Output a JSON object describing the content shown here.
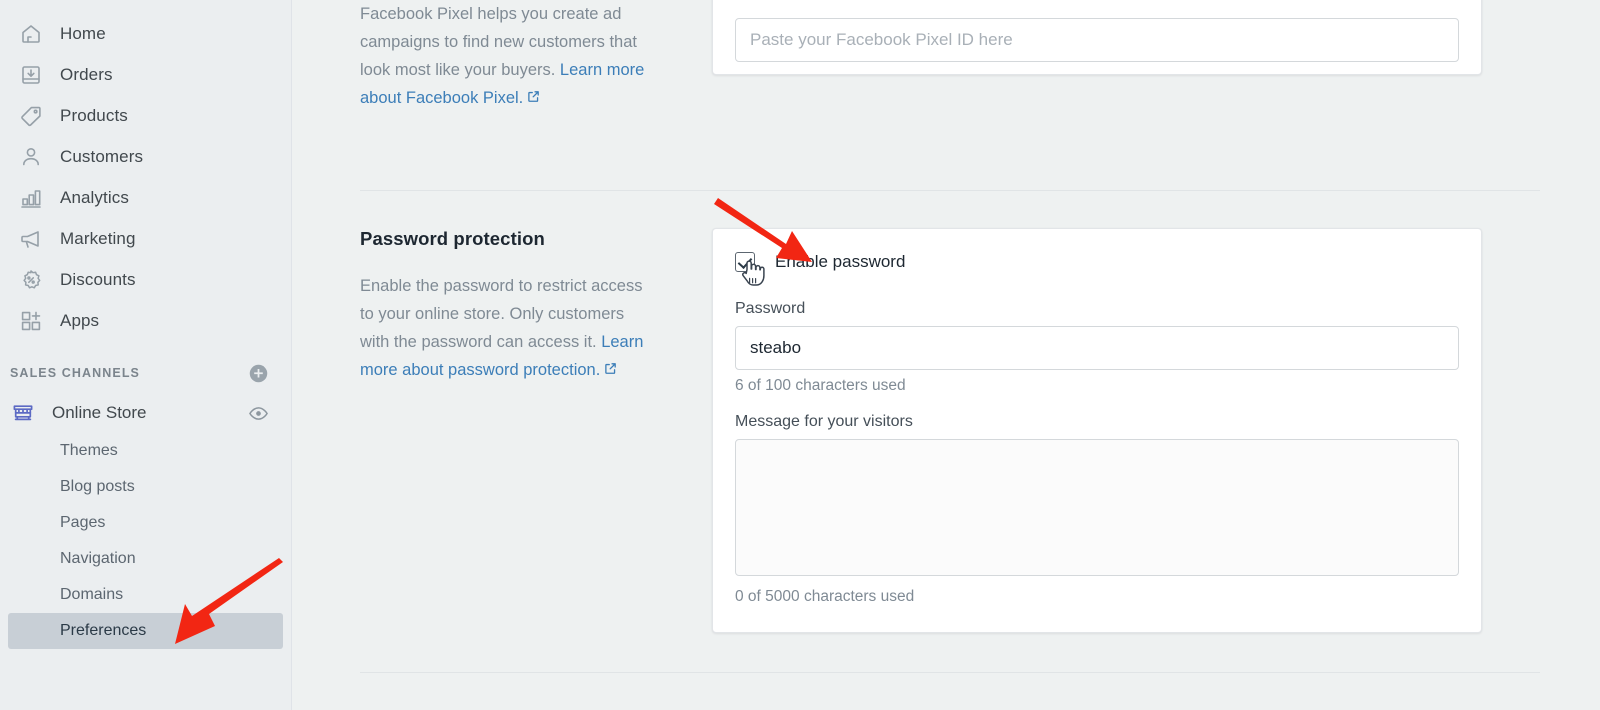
{
  "sidebar": {
    "nav": [
      {
        "label": "Home",
        "icon": "home-icon"
      },
      {
        "label": "Orders",
        "icon": "orders-icon"
      },
      {
        "label": "Products",
        "icon": "products-tag-icon"
      },
      {
        "label": "Customers",
        "icon": "customers-person-icon"
      },
      {
        "label": "Analytics",
        "icon": "analytics-bar-chart-icon"
      },
      {
        "label": "Marketing",
        "icon": "marketing-megaphone-icon"
      },
      {
        "label": "Discounts",
        "icon": "discounts-percent-badge-icon"
      },
      {
        "label": "Apps",
        "icon": "apps-grid-plus-icon"
      }
    ],
    "sales_channels": {
      "title": "SALES CHANNELS",
      "add_icon": "plus-circle-icon",
      "channel": {
        "name": "Online Store",
        "icon": "online-store-shop-icon",
        "icon_color": "#5c6ac4",
        "view_icon": "eye-icon"
      },
      "sub_items": [
        {
          "label": "Themes",
          "active": false
        },
        {
          "label": "Blog posts",
          "active": false
        },
        {
          "label": "Pages",
          "active": false
        },
        {
          "label": "Navigation",
          "active": false
        },
        {
          "label": "Domains",
          "active": false
        },
        {
          "label": "Preferences",
          "active": true
        }
      ]
    }
  },
  "facebook_pixel": {
    "description_1": "Facebook Pixel helps you create ad campaigns to find new customers that look most like your buyers. ",
    "link_text": "Learn more about Facebook Pixel.",
    "link_icon": "external-link-icon",
    "input_placeholder": "Paste your Facebook Pixel ID here",
    "input_value": ""
  },
  "password_protection": {
    "title": "Password protection",
    "description_1": "Enable the password to restrict access to your online store. Only customers with the password can access it. ",
    "link_text": "Learn more about password protection.",
    "link_icon": "external-link-icon",
    "enable_checkbox_label": "Enable password",
    "enable_checked": true,
    "password_label": "Password",
    "password_value": "steabo",
    "password_counter": "6 of 100 characters used",
    "message_label": "Message for your visitors",
    "message_value": "",
    "message_placeholder": "",
    "message_counter": "0 of 5000 characters used"
  },
  "annotations": {
    "arrow_color": "#f22613",
    "arrow_to_checkbox": "arrow-pointing-to-enable-password-checkbox",
    "arrow_to_preferences": "arrow-pointing-to-preferences-menu-item",
    "cursor": "hand-pointer-cursor"
  }
}
